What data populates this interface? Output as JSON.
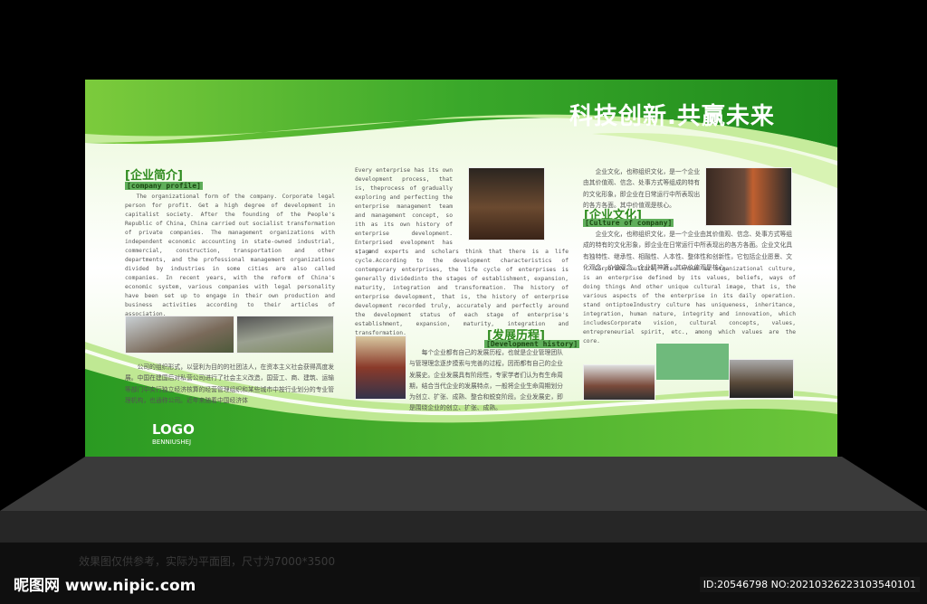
{
  "board": {
    "title": "科技创新.共赢未来",
    "profile": {
      "heading": "[企业简介]",
      "subheading": "[company profile]",
      "body_en": "The organizational form of the company. Corporate legal person for profit. Get a high degree of development in capitalist society. After the founding of the People's Republic of China, China carried out socialist transformation of private companies. The management organizations with independent economic accounting in state-owned industrial, commercial, construction, transportation and other departments, and the professional management organizations divided by industries in some cities are also called companies. In recent years, with the reform of China's economic system, various companies with legal personality have been set up to engage in their own production and business activities according to their articles of association.",
      "body_cn": "公司的组织形式，以营利为目的的社团法人，在资本主义社会获得高度发展。中国在建国后对私营公司进行了社会主义改造，国营工、商、建筑、运输等部门中实行独立经济核算的经营管理组织和某些城市中按行业划分的专业管理机构，也通称公司。近年来随着中国经济体"
    },
    "history": {
      "heading": "[发展历程]",
      "subheading": "[Development history]",
      "body_en_top": "Every enterprise has its own development process, that is, theprocess of gradually exploring and perfecting the enterprise management team and management concept, so ith as its own history of enterprise development. Enterprised evelopment has stage",
      "body_en_bottom": "s, and experts and scholars think that there is a life cycle.According to the development characteristics of contemporary enterprises, the life cycle of enterprises is generally dividedinto the stages of establishment, expansion, maturity, integration and transformation. The history of enterprise development, that is, the history of enterprise development recorded truly, accurately and perfectly around the development status of each stage of enterprise's establishment, expansion, maturity, integration and transformation.",
      "body_cn": "每个企业都有自己的发展历程，也就是企业管理团队与管理理念逐步摸索与完善的过程，因而都有自己的企业发展史。企业发展具有阶段性，专家学者们认为有生命周期，结合当代企业的发展特点，一般将企业生命周期划分为创立、扩张、成熟、整合和蜕变阶段。企业发展史，即是围绕企业的创立、扩张、成熟。"
    },
    "culture": {
      "heading": "[企业文化]",
      "subheading": "[Culture of company]",
      "body_cn_top": "企业文化，也称组织文化，是一个企业由其价值观、信念、处事方式等组成的特有的文化形象，即企业在日常运行中所表现出的各方各面。其中价值观是核心。",
      "body_cn": "企业文化，也称组织文化，是一个企业由其价值观、信念、处事方式等组成的特有的文化形象，即企业在日常运行中所表现出的各方各面。企业文化具有独特性、继承性、相融性、人本性、整体性和创新性，它包括企业愿景、文化观念、价值观念、企业精神等，其中价值观是核心。",
      "body_en": "Corporate culture, also known as organizational culture, is an enterprise defined by its values, beliefs, ways of doing things And other unique cultural image, that is, the various aspects of the enterprise in its daily operation. stand ontiptoeIndustry culture has uniqueness, inheritance, integration, human nature, integrity and innovation, which includesCorporate vision, cultural concepts, values, entrepreneurial spirit, etc., among which values are the core."
    },
    "logo": {
      "text": "LOGO",
      "sub": "BENNIUSHEJ"
    }
  },
  "footer": {
    "note": "效果图仅供参考，实际为平面图，尺寸为7000*3500",
    "watermark": "昵图网 www.nipic.com",
    "id": "ID:20546798 NO:20210326223103540101"
  }
}
